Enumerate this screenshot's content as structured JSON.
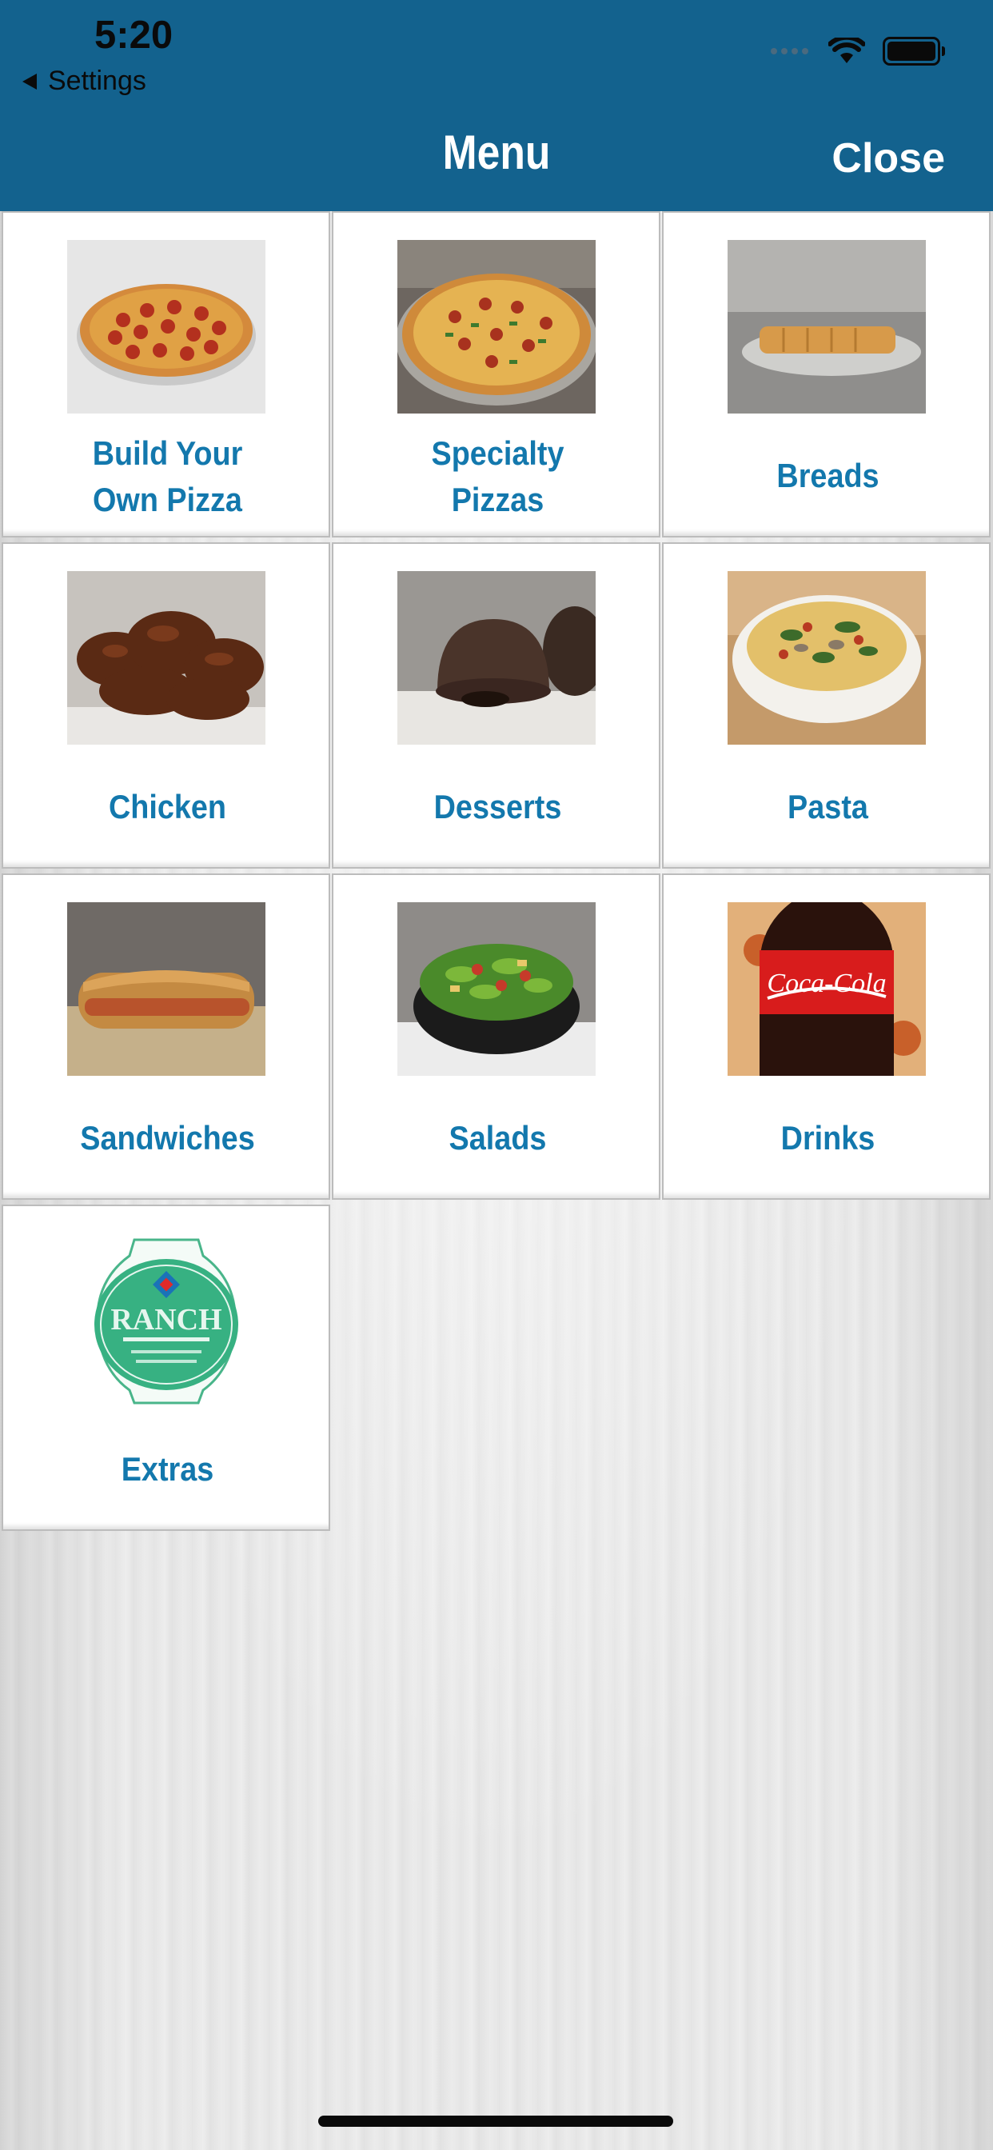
{
  "status_bar": {
    "time": "5:20",
    "back_label": "Settings"
  },
  "nav": {
    "title": "Menu",
    "close_label": "Close"
  },
  "menu_items": [
    {
      "label": "Build Your Own Pizza",
      "line1": "Build Your",
      "line2": "Own Pizza",
      "icon": "pepperoni-pizza-image"
    },
    {
      "label": "Specialty Pizzas",
      "line1": "Specialty",
      "line2": "Pizzas",
      "icon": "specialty-pizza-image"
    },
    {
      "label": "Breads",
      "icon": "bread-image"
    },
    {
      "label": "Chicken",
      "icon": "chicken-wings-image"
    },
    {
      "label": "Desserts",
      "icon": "lava-cake-image"
    },
    {
      "label": "Pasta",
      "icon": "pasta-bowl-image"
    },
    {
      "label": "Sandwiches",
      "icon": "sandwich-image"
    },
    {
      "label": "Salads",
      "icon": "salad-image"
    },
    {
      "label": "Drinks",
      "icon": "soda-bottle-image"
    },
    {
      "label": "Extras",
      "icon": "ranch-cup-image"
    }
  ],
  "colors": {
    "nav_bar": "#13628e",
    "label_text": "#1378ad",
    "tile_bg": "#ffffff"
  }
}
